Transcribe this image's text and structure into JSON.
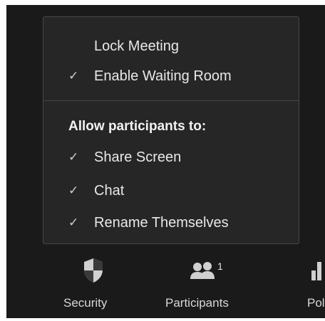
{
  "menu": {
    "top_items": [
      {
        "label": "Lock Meeting",
        "checked": false
      },
      {
        "label": "Enable Waiting Room",
        "checked": true
      }
    ],
    "section_header": "Allow participants to:",
    "participant_items": [
      {
        "label": "Share Screen",
        "checked": true
      },
      {
        "label": "Chat",
        "checked": true
      },
      {
        "label": "Rename Themselves",
        "checked": true
      }
    ],
    "check_glyph": "✓"
  },
  "toolbar": {
    "security_label": "Security",
    "security_icon": "shield-icon",
    "participants_label": "Participants",
    "participants_icon": "participants-icon",
    "participants_count": "1",
    "polls_label": "Pol",
    "polls_icon": "polls-icon"
  },
  "colors": {
    "background": "#1a1a1a",
    "menu_background": "#262626",
    "border": "#474747",
    "text": "#e8e8e8"
  }
}
